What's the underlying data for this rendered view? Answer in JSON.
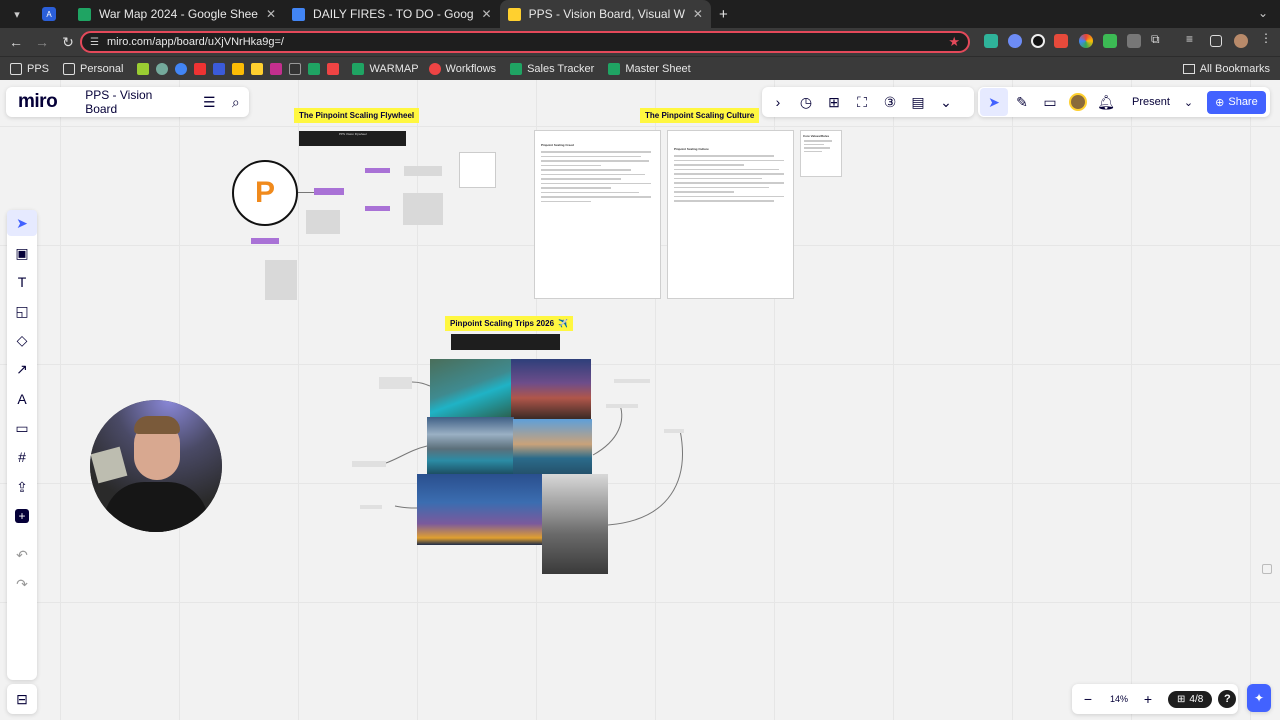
{
  "browser": {
    "tabs": [
      {
        "label": "War Map 2024 - Google Shee",
        "favicon": "sheets-icon",
        "color": "#1fa463",
        "active": false
      },
      {
        "label": "DAILY FIRES - TO DO - Goog",
        "favicon": "docs-icon",
        "color": "#4285f4",
        "active": false
      },
      {
        "label": "PPS - Vision Board, Visual W",
        "favicon": "miro-icon",
        "color": "#ffd02f",
        "active": true
      }
    ],
    "url": "miro.com/app/board/uXjVNrHka9g=/",
    "bookmarks": [
      {
        "label": "PPS",
        "icon": "folder-icon"
      },
      {
        "label": "Personal",
        "icon": "folder-icon"
      },
      {
        "label": "",
        "icon": "sheets-icon"
      },
      {
        "label": "WARMAP",
        "icon": "sheets-icon"
      },
      {
        "label": "Workflows",
        "icon": "bookmark-icon"
      },
      {
        "label": "Sales Tracker",
        "icon": "sheets-icon"
      },
      {
        "label": "Master Sheet",
        "icon": "sheets-icon"
      }
    ],
    "all_bookmarks": "All Bookmarks"
  },
  "miro": {
    "logo": "miro",
    "board_title": "PPS - Vision Board",
    "present_label": "Present",
    "share_label": "Share",
    "zoom": "14%",
    "pages": "4/8",
    "help": "?"
  },
  "board": {
    "flywheel_title": "The Pinpoint Scaling Flywheel",
    "flywheel_caption": "PPS Vision Flywheel",
    "logo_letter": "P",
    "culture_title": "The Pinpoint Scaling Culture",
    "trips_title": "Pinpoint Scaling Trips 2026",
    "trips_emoji": "✈️",
    "doc1_heading": "Pinpoint Scaling Creed",
    "doc2_heading": "Pinpoint Scaling Culture",
    "doc3_heading": "Core Values/Rules"
  },
  "colors": {
    "accent": "#4262ff",
    "sticky": "#fff740",
    "brand_orange": "#f08a1c",
    "purple_node": "#a972d6"
  }
}
